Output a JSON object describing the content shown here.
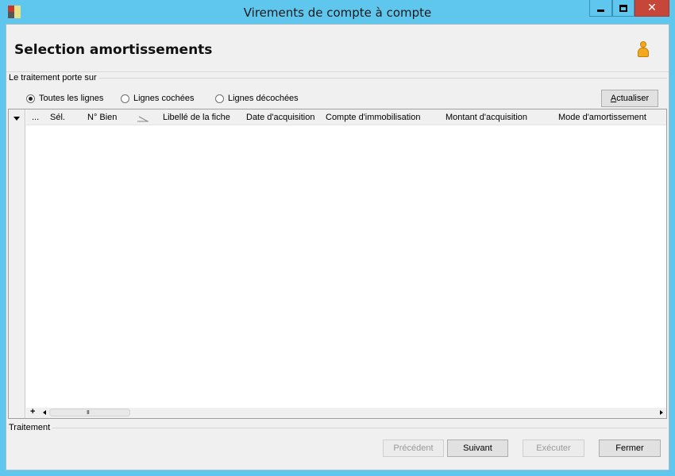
{
  "window": {
    "title": "Virements de compte à compte",
    "controls": {
      "minimize": "minimize",
      "maximize": "maximize",
      "close": "✕"
    }
  },
  "header": {
    "title": "Selection amortissements",
    "icon": "user-icon"
  },
  "scope_group": {
    "label": "Le traitement porte sur",
    "options": [
      {
        "label": "Toutes les lignes",
        "selected": true
      },
      {
        "label": "Lignes cochées",
        "selected": false
      },
      {
        "label": "Lignes décochées",
        "selected": false
      }
    ],
    "refresh_label_pre": "",
    "refresh_label_ul": "A",
    "refresh_label_post": "ctualiser"
  },
  "grid": {
    "columns": [
      "...",
      "Sél.",
      "N° Bien",
      "Libellé de",
      "la fiche",
      "Date d'acquisition",
      "Compte d'immobilisation",
      "Montant d'acquisition",
      "Mode d'amortissement"
    ],
    "rows": [],
    "footer_add": "+",
    "scroll_grip": "III"
  },
  "processing_group": {
    "label": "Traitement"
  },
  "footer": {
    "previous": "Précédent",
    "next": "Suivant",
    "execute": "Exécuter",
    "close": "Fermer"
  },
  "colors": {
    "titlebar": "#5fc6ee",
    "close_button": "#c7463a",
    "client_background": "#f0f0f0",
    "primary_border": "#0078d7"
  }
}
